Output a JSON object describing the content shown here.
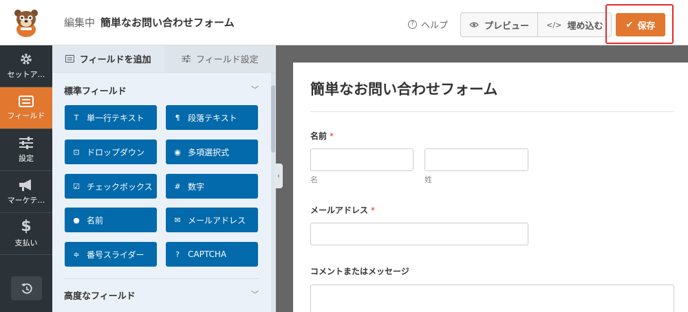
{
  "header": {
    "editing_label": "編集中",
    "form_name": "簡単なお問い合わせフォーム",
    "help_label": "ヘルプ",
    "preview_label": "プレビュー",
    "embed_label": "埋め込む",
    "save_label": "保存"
  },
  "rail": {
    "items": [
      {
        "label": "セットア…",
        "icon": "gear-icon"
      },
      {
        "label": "フィールド",
        "icon": "fields-icon",
        "active": true
      },
      {
        "label": "設定",
        "icon": "sliders-icon"
      },
      {
        "label": "マーケテ…",
        "icon": "megaphone-icon"
      },
      {
        "label": "支払い",
        "icon": "dollar-icon"
      }
    ],
    "undo_icon": "history-icon"
  },
  "panel": {
    "tabs": [
      {
        "label": "フィールドを追加",
        "active": true
      },
      {
        "label": "フィールド設定",
        "active": false
      }
    ],
    "standard_section": "標準フィールド",
    "advanced_section": "高度なフィールド",
    "fields": [
      {
        "label": "単一行テキスト",
        "icon": "text-icon"
      },
      {
        "label": "段落テキスト",
        "icon": "paragraph-icon"
      },
      {
        "label": "ドロップダウン",
        "icon": "dropdown-icon"
      },
      {
        "label": "多項選択式",
        "icon": "radio-icon"
      },
      {
        "label": "チェックボックス",
        "icon": "checkbox-icon"
      },
      {
        "label": "数字",
        "icon": "hash-icon"
      },
      {
        "label": "名前",
        "icon": "user-icon"
      },
      {
        "label": "メールアドレス",
        "icon": "envelope-icon"
      },
      {
        "label": "番号スライダー",
        "icon": "slider-icon"
      },
      {
        "label": "CAPTCHA",
        "icon": "question-icon"
      }
    ]
  },
  "form": {
    "title": "簡単なお問い合わせフォーム",
    "name_label": "名前",
    "first_sublabel": "名",
    "last_sublabel": "姓",
    "email_label": "メールアドレス",
    "comment_label": "コメントまたはメッセージ",
    "required_mark": "*"
  },
  "colors": {
    "accent": "#e27730",
    "field_button": "#036aab",
    "rail_bg": "#2c3338",
    "save_highlight": "#e4262a"
  }
}
